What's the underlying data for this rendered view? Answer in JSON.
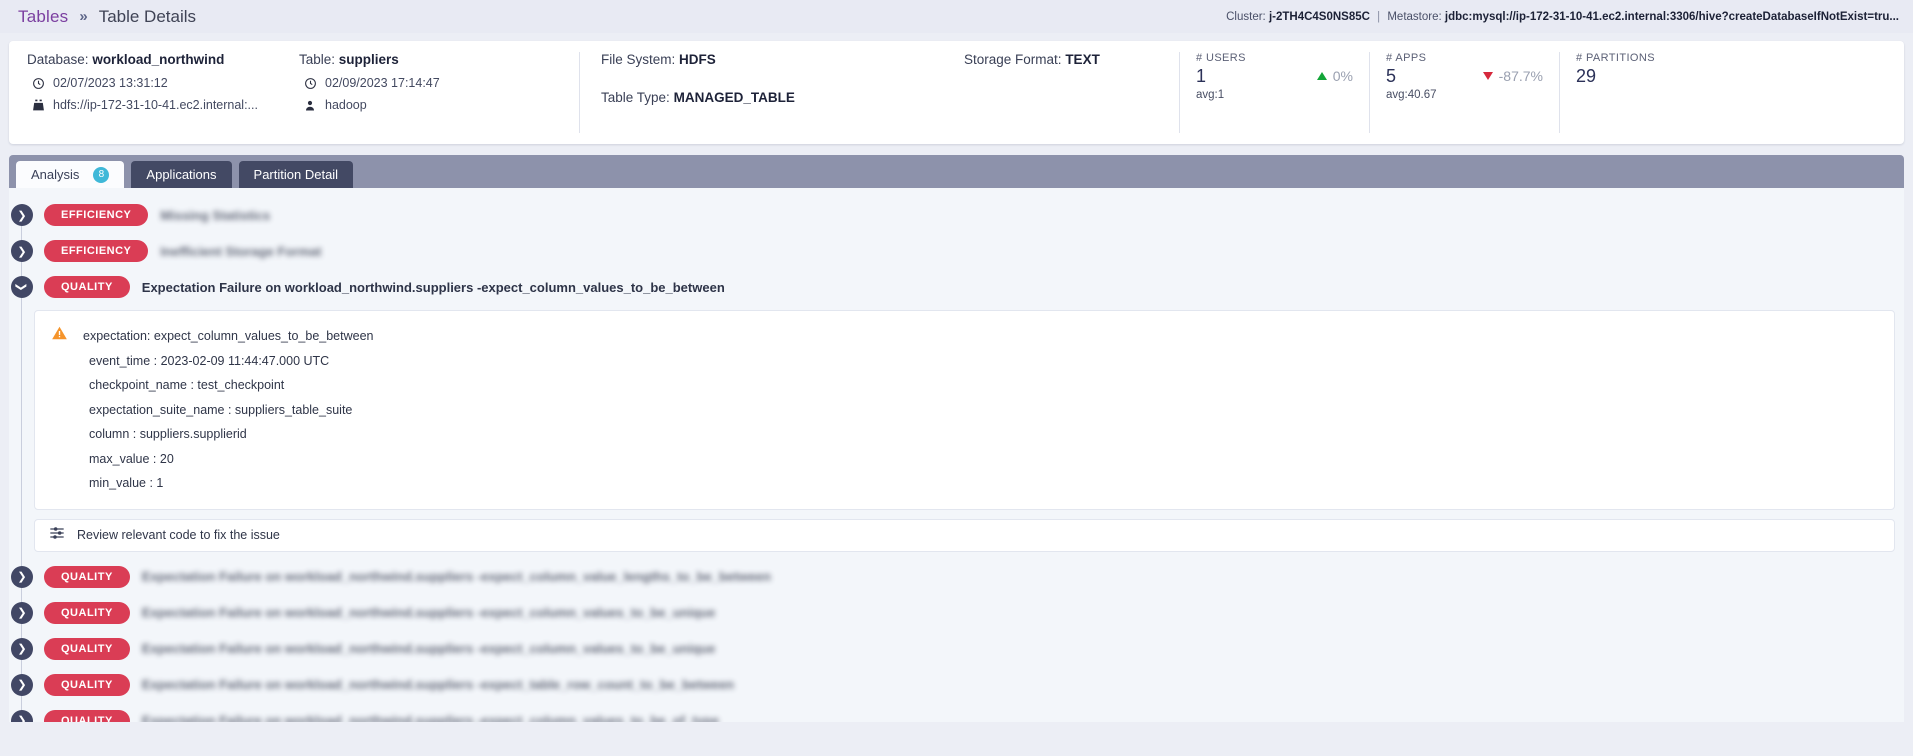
{
  "breadcrumb": {
    "root": "Tables",
    "separator": "»",
    "current": "Table Details"
  },
  "cluster_bar": {
    "cluster_label": "Cluster:",
    "cluster_value": "j-2TH4C4S0NS85C",
    "separator": "|",
    "metastore_label": "Metastore:",
    "metastore_value": "jdbc:mysql://ip-172-31-10-41.ec2.internal:3306/hive?createDatabaseIfNotExist=tru..."
  },
  "info": {
    "database_label": "Database:",
    "database_value": "workload_northwind",
    "database_time": "02/07/2023 13:31:12",
    "database_path": "hdfs://ip-172-31-10-41.ec2.internal:...",
    "table_label": "Table:",
    "table_value": "suppliers",
    "table_time": "02/09/2023 17:14:47",
    "table_owner": "hadoop",
    "file_system_label": "File System:",
    "file_system_value": "HDFS",
    "table_type_label": "Table Type:",
    "table_type_value": "MANAGED_TABLE",
    "storage_format_label": "Storage Format:",
    "storage_format_value": "TEXT"
  },
  "metrics": [
    {
      "label": "# USERS",
      "value": "1",
      "delta": "0%",
      "direction": "up",
      "avg": "avg:1",
      "delta_color": "#13a538"
    },
    {
      "label": "# APPS",
      "value": "5",
      "delta": "-87.7%",
      "direction": "down",
      "avg": "avg:40.67",
      "delta_color": "#d6283c"
    },
    {
      "label": "# PARTITIONS",
      "value": "29",
      "delta": "",
      "direction": "none",
      "avg": "",
      "delta_color": ""
    }
  ],
  "tabs": [
    {
      "label": "Analysis",
      "badge": "8",
      "active": true
    },
    {
      "label": "Applications",
      "badge": "",
      "active": false
    },
    {
      "label": "Partition Detail",
      "badge": "",
      "active": false
    }
  ],
  "analysis": {
    "rows_top": [
      {
        "category": "EFFICIENCY",
        "title": "Missing Statistics",
        "expanded": false,
        "blurred": true
      },
      {
        "category": "EFFICIENCY",
        "title": "Inefficient Storage Format",
        "expanded": false,
        "blurred": true
      }
    ],
    "expanded_row": {
      "category": "QUALITY",
      "title": "Expectation Failure on workload_northwind.suppliers -expect_column_values_to_be_between",
      "expanded": true,
      "details": [
        "expectation: expect_column_values_to_be_between",
        "event_time : 2023-02-09 11:44:47.000 UTC",
        "checkpoint_name : test_checkpoint",
        "expectation_suite_name : suppliers_table_suite",
        "column : suppliers.supplierid",
        "max_value : 20",
        "min_value : 1"
      ],
      "action_label": "Review relevant code to fix the issue"
    },
    "rows_bottom": [
      {
        "category": "QUALITY",
        "title": "Expectation Failure on workload_northwind.suppliers -expect_column_value_lengths_to_be_between",
        "expanded": false,
        "blurred": true
      },
      {
        "category": "QUALITY",
        "title": "Expectation Failure on workload_northwind.suppliers -expect_column_values_to_be_unique",
        "expanded": false,
        "blurred": true
      },
      {
        "category": "QUALITY",
        "title": "Expectation Failure on workload_northwind.suppliers -expect_column_values_to_be_unique",
        "expanded": false,
        "blurred": true
      },
      {
        "category": "QUALITY",
        "title": "Expectation Failure on workload_northwind.suppliers -expect_table_row_count_to_be_between",
        "expanded": false,
        "blurred": true
      },
      {
        "category": "QUALITY",
        "title": "Expectation Failure on workload_northwind.suppliers -expect_column_values_to_be_of_type",
        "expanded": false,
        "blurred": true
      }
    ]
  },
  "colors": {
    "accent_link": "#7b3fa0",
    "badge_red": "#da3d55",
    "tab_active_bg": "#fbfcfe",
    "tab_inactive_bg": "#434964",
    "tabbar_bg": "#8d92ab",
    "badge_count_bg": "#3fb8d8",
    "warning_orange": "#f5942b",
    "positive_green": "#13a538",
    "negative_red": "#d6283c"
  }
}
